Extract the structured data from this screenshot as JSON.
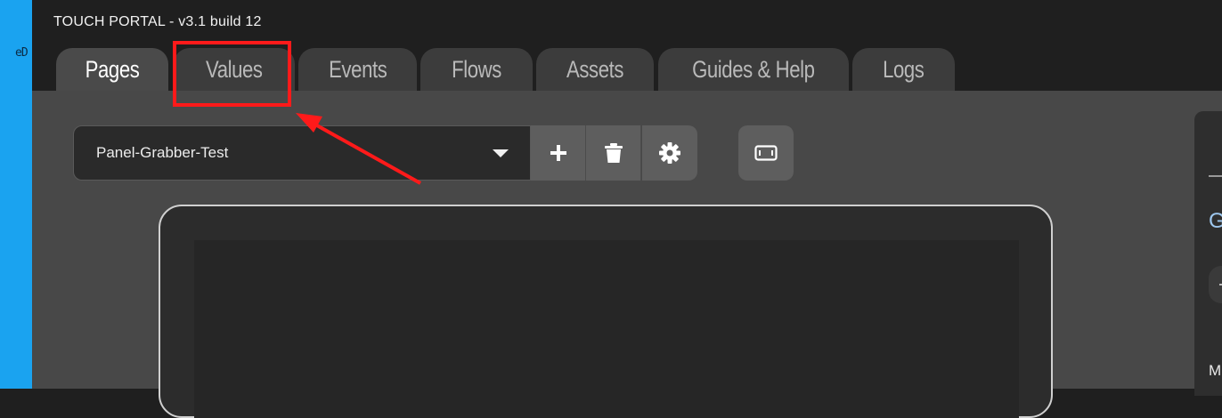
{
  "desktop": {
    "edge_text": "eD"
  },
  "app": {
    "title": "TOUCH PORTAL - v3.1 build 12",
    "tabs": [
      {
        "label": "Pages",
        "active": true
      },
      {
        "label": "Values",
        "active": false
      },
      {
        "label": "Events",
        "active": false
      },
      {
        "label": "Flows",
        "active": false
      },
      {
        "label": "Assets",
        "active": false
      },
      {
        "label": "Guides & Help",
        "active": false
      },
      {
        "label": "Logs",
        "active": false
      }
    ]
  },
  "page_toolbar": {
    "selected_page": "Panel-Grabber-Test",
    "buttons": [
      {
        "icon": "plus-icon"
      },
      {
        "icon": "trash-icon"
      },
      {
        "icon": "gear-icon"
      },
      {
        "icon": "device-orientation-icon"
      }
    ]
  },
  "right_panel": {
    "heading_fragment": "Gl",
    "label_fragment": "M"
  },
  "annotation": {
    "color": "#ff1a1a"
  },
  "colors": {
    "titlebar": "#1f1f1f",
    "content": "#484848",
    "tab_inactive": "#3c3c3c",
    "tab_active": "#4a4a4a",
    "button": "#5e5e5e",
    "desktop": "#1aa3f0"
  }
}
